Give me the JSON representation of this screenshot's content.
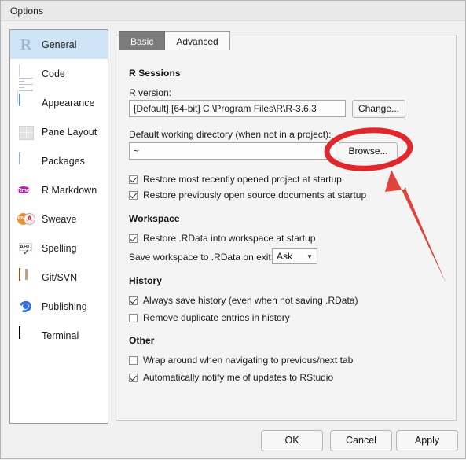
{
  "window": {
    "title": "Options"
  },
  "sidebar": {
    "items": [
      {
        "label": "General",
        "icon": "r-logo-icon",
        "selected": true
      },
      {
        "label": "Code",
        "icon": "code-icon",
        "selected": false
      },
      {
        "label": "Appearance",
        "icon": "appearance-icon",
        "selected": false
      },
      {
        "label": "Pane Layout",
        "icon": "pane-layout-icon",
        "selected": false
      },
      {
        "label": "Packages",
        "icon": "packages-icon",
        "selected": false
      },
      {
        "label": "R Markdown",
        "icon": "r-markdown-icon",
        "selected": false
      },
      {
        "label": "Sweave",
        "icon": "sweave-icon",
        "selected": false
      },
      {
        "label": "Spelling",
        "icon": "spelling-icon",
        "selected": false
      },
      {
        "label": "Git/SVN",
        "icon": "git-svn-icon",
        "selected": false
      },
      {
        "label": "Publishing",
        "icon": "publishing-icon",
        "selected": false
      },
      {
        "label": "Terminal",
        "icon": "terminal-icon",
        "selected": false
      }
    ],
    "icon_glyphs": {
      "r_logo": "R",
      "rmd": "Rmd",
      "sweave": "RNW",
      "sweave_pdf": "A",
      "spelling": "ABC"
    }
  },
  "main": {
    "tabs": [
      {
        "label": "Basic",
        "active": true
      },
      {
        "label": "Advanced",
        "active": false
      }
    ],
    "sections": {
      "r_sessions": {
        "heading": "R Sessions",
        "r_version_label": "R version:",
        "r_version_value": "[Default] [64-bit] C:\\Program Files\\R\\R-3.6.3",
        "change_button": "Change...",
        "working_dir_label": "Default working directory (when not in a project):",
        "working_dir_value": "~",
        "browse_button": "Browse...",
        "checkboxes": [
          {
            "label": "Restore most recently opened project at startup",
            "checked": true
          },
          {
            "label": "Restore previously open source documents at startup",
            "checked": true
          }
        ]
      },
      "workspace": {
        "heading": "Workspace",
        "checkboxes": [
          {
            "label": "Restore .RData into workspace at startup",
            "checked": true
          }
        ],
        "save_workspace_label": "Save workspace to .RData on exit:",
        "save_workspace_value": "Ask"
      },
      "history": {
        "heading": "History",
        "checkboxes": [
          {
            "label": "Always save history (even when not saving .RData)",
            "checked": true
          },
          {
            "label": "Remove duplicate entries in history",
            "checked": false
          }
        ]
      },
      "other": {
        "heading": "Other",
        "checkboxes": [
          {
            "label": "Wrap around when navigating to previous/next tab",
            "checked": false
          },
          {
            "label": "Automatically notify me of updates to RStudio",
            "checked": true
          }
        ]
      }
    }
  },
  "footer": {
    "ok": "OK",
    "cancel": "Cancel",
    "apply": "Apply"
  },
  "annotation": {
    "color": "#e0272c",
    "highlight_target": "browse-button",
    "shapes": [
      "ellipse",
      "arrow"
    ]
  }
}
